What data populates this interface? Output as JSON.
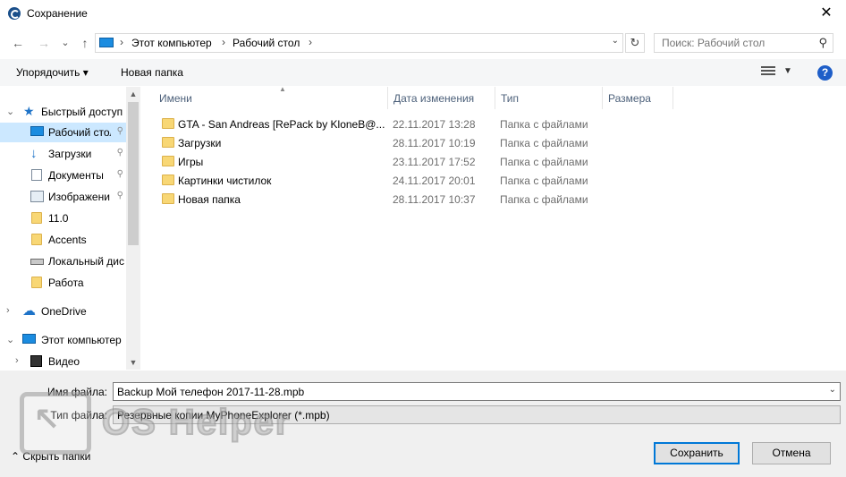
{
  "window": {
    "title": "Сохранение",
    "close_glyph": "✕"
  },
  "nav": {
    "back_glyph": "←",
    "forward_glyph": "→",
    "recent_glyph": "⌄",
    "up_glyph": "↑",
    "breadcrumbs": [
      "Этот компьютер",
      "Рабочий стол"
    ],
    "search_placeholder": "Поиск: Рабочий стол"
  },
  "toolbar": {
    "organize_label": "Упорядочить ▾",
    "new_folder_label": "Новая папка",
    "help_label": "?"
  },
  "sidebar": {
    "items": [
      {
        "label": "Быстрый доступ",
        "icon": "star-icon",
        "expanded": true
      },
      {
        "label": "Рабочий стол",
        "icon": "desktop-icon",
        "pinned": true,
        "selected": true
      },
      {
        "label": "Загрузки",
        "icon": "download-icon",
        "pinned": true
      },
      {
        "label": "Документы",
        "icon": "document-icon",
        "pinned": true
      },
      {
        "label": "Изображени",
        "icon": "pictures-icon",
        "pinned": true
      },
      {
        "label": "11.0",
        "icon": "folder-icon"
      },
      {
        "label": "Accents",
        "icon": "folder-icon"
      },
      {
        "label": "Локальный дис",
        "icon": "drive-icon"
      },
      {
        "label": "Работа",
        "icon": "folder-icon"
      },
      {
        "label": "OneDrive",
        "icon": "cloud-icon",
        "expanded": false
      },
      {
        "label": "Этот компьютер",
        "icon": "computer-icon",
        "expanded": true
      },
      {
        "label": "Видео",
        "icon": "video-icon",
        "expanded": false
      }
    ]
  },
  "file_list": {
    "columns": [
      "Имени",
      "Дата изменения",
      "Тип",
      "Размера"
    ],
    "rows": [
      {
        "name": "GTA - San Andreas [RePack by KloneB@...",
        "date": "22.11.2017 13:28",
        "type": "Папка с файлами"
      },
      {
        "name": "Загрузки",
        "date": "28.11.2017 10:19",
        "type": "Папка с файлами"
      },
      {
        "name": "Игры",
        "date": "23.11.2017 17:52",
        "type": "Папка с файлами"
      },
      {
        "name": "Картинки чистилок",
        "date": "24.11.2017 20:01",
        "type": "Папка с файлами"
      },
      {
        "name": "Новая папка",
        "date": "28.11.2017 10:37",
        "type": "Папка с файлами"
      }
    ]
  },
  "save_panel": {
    "file_name_label": "Имя файла:",
    "file_name_value": "Backup Мой телефон 2017-11-28.mpb",
    "file_type_label": "Тип файла:",
    "file_type_value": "Резервные копии MyPhoneExplorer (*.mpb)",
    "hide_folders_label": "Скрыть папки",
    "save_label": "Сохранить",
    "cancel_label": "Отмена"
  },
  "watermark": {
    "text": "OS Helper"
  }
}
